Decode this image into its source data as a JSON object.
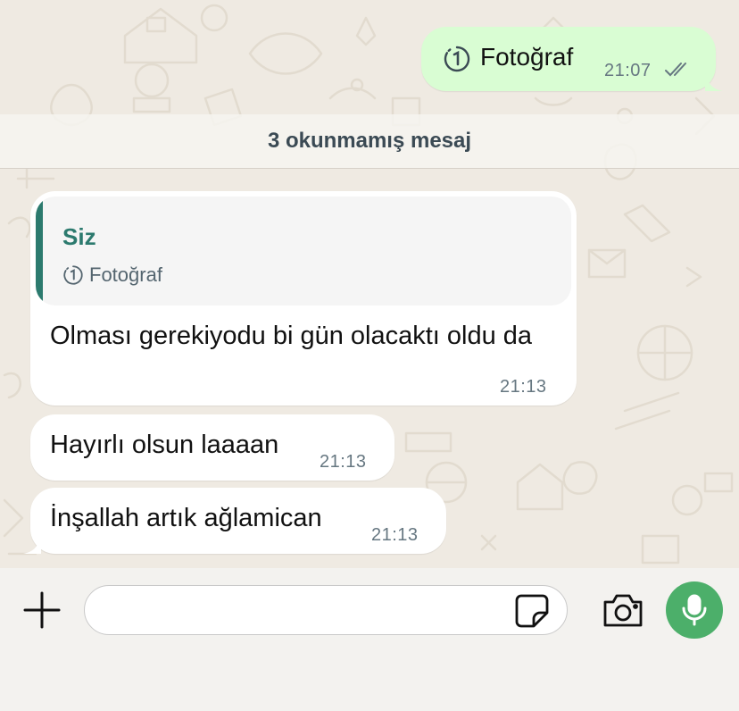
{
  "outgoing_message": {
    "icon": "view-once-icon",
    "text": "Fotoğraf",
    "time": "21:07",
    "status_icon": "double-check-icon"
  },
  "unread_banner": {
    "text": "3 okunmamış mesaj"
  },
  "incoming_messages": [
    {
      "quote": {
        "author": "Siz",
        "icon": "view-once-icon",
        "text": "Fotoğraf"
      },
      "text": "Olması gerekiyodu bi gün olacaktı oldu da",
      "time": "21:13"
    },
    {
      "text": "Hayırlı olsun laaaan",
      "time": "21:13"
    },
    {
      "text": "İnşallah artık ağlamican",
      "time": "21:13"
    }
  ],
  "input_bar": {
    "value": "",
    "plus_icon": "plus-icon",
    "sticker_icon": "sticker-icon",
    "camera_icon": "camera-icon",
    "mic_icon": "microphone-icon"
  },
  "colors": {
    "chat_background": "#efeae2",
    "outgoing_bubble": "#d9fdd3",
    "incoming_bubble": "#ffffff",
    "quote_accent": "#2c7a6e",
    "mic_button": "#4caf6a",
    "timestamp": "#667781"
  }
}
